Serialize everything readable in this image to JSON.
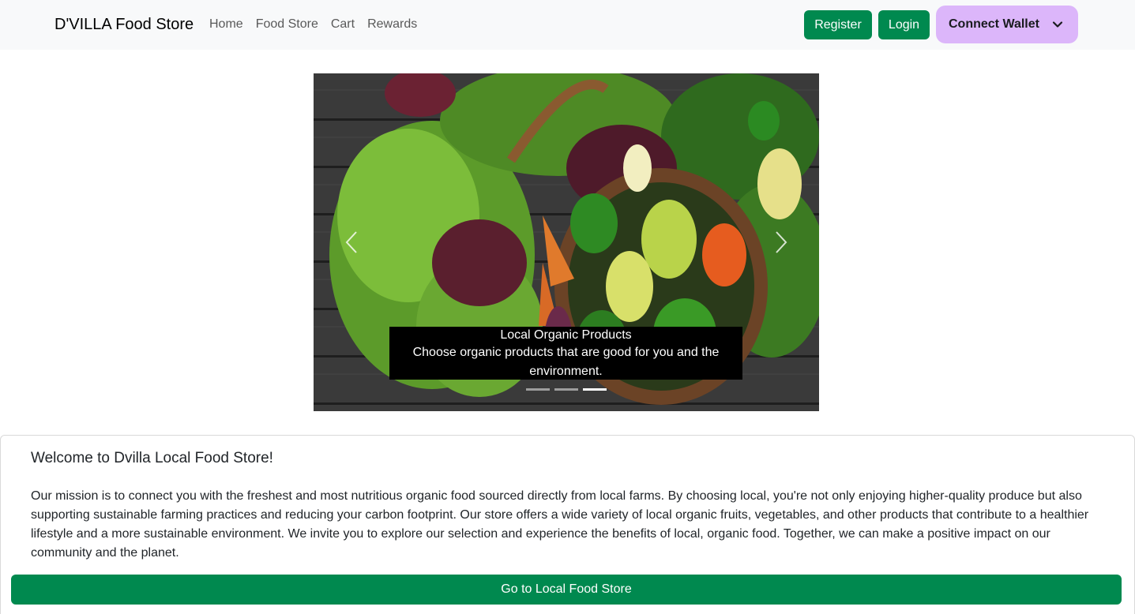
{
  "navbar": {
    "brand": "D'VILLA Food Store",
    "links": [
      "Home",
      "Food Store",
      "Cart",
      "Rewards"
    ],
    "register_label": "Register",
    "login_label": "Login",
    "wallet_label": "Connect Wallet",
    "colors": {
      "nav_bg": "#f8f9fa",
      "green": "#00894f",
      "wallet_bg": "#dcb6fa"
    }
  },
  "carousel": {
    "caption_title": "Local Organic Products",
    "caption_text": "Choose organic products that are good for you and the environment.",
    "slide_count": 3,
    "active_slide": 3,
    "prev_icon": "chevron-left-icon",
    "next_icon": "chevron-right-icon"
  },
  "card": {
    "title": "Welcome to Dvilla Local Food Store!",
    "text": "Our mission is to connect you with the freshest and most nutritious organic food sourced directly from local farms. By choosing local, you're not only enjoying higher-quality produce but also supporting sustainable farming practices and reducing your carbon footprint. Our store offers a wide variety of local organic fruits, vegetables, and other products that contribute to a healthier lifestyle and a more sustainable environment. We invite you to explore our selection and experience the benefits of local, organic food. Together, we can make a positive impact on our community and the planet.",
    "button_label": "Go to Local Food Store"
  }
}
